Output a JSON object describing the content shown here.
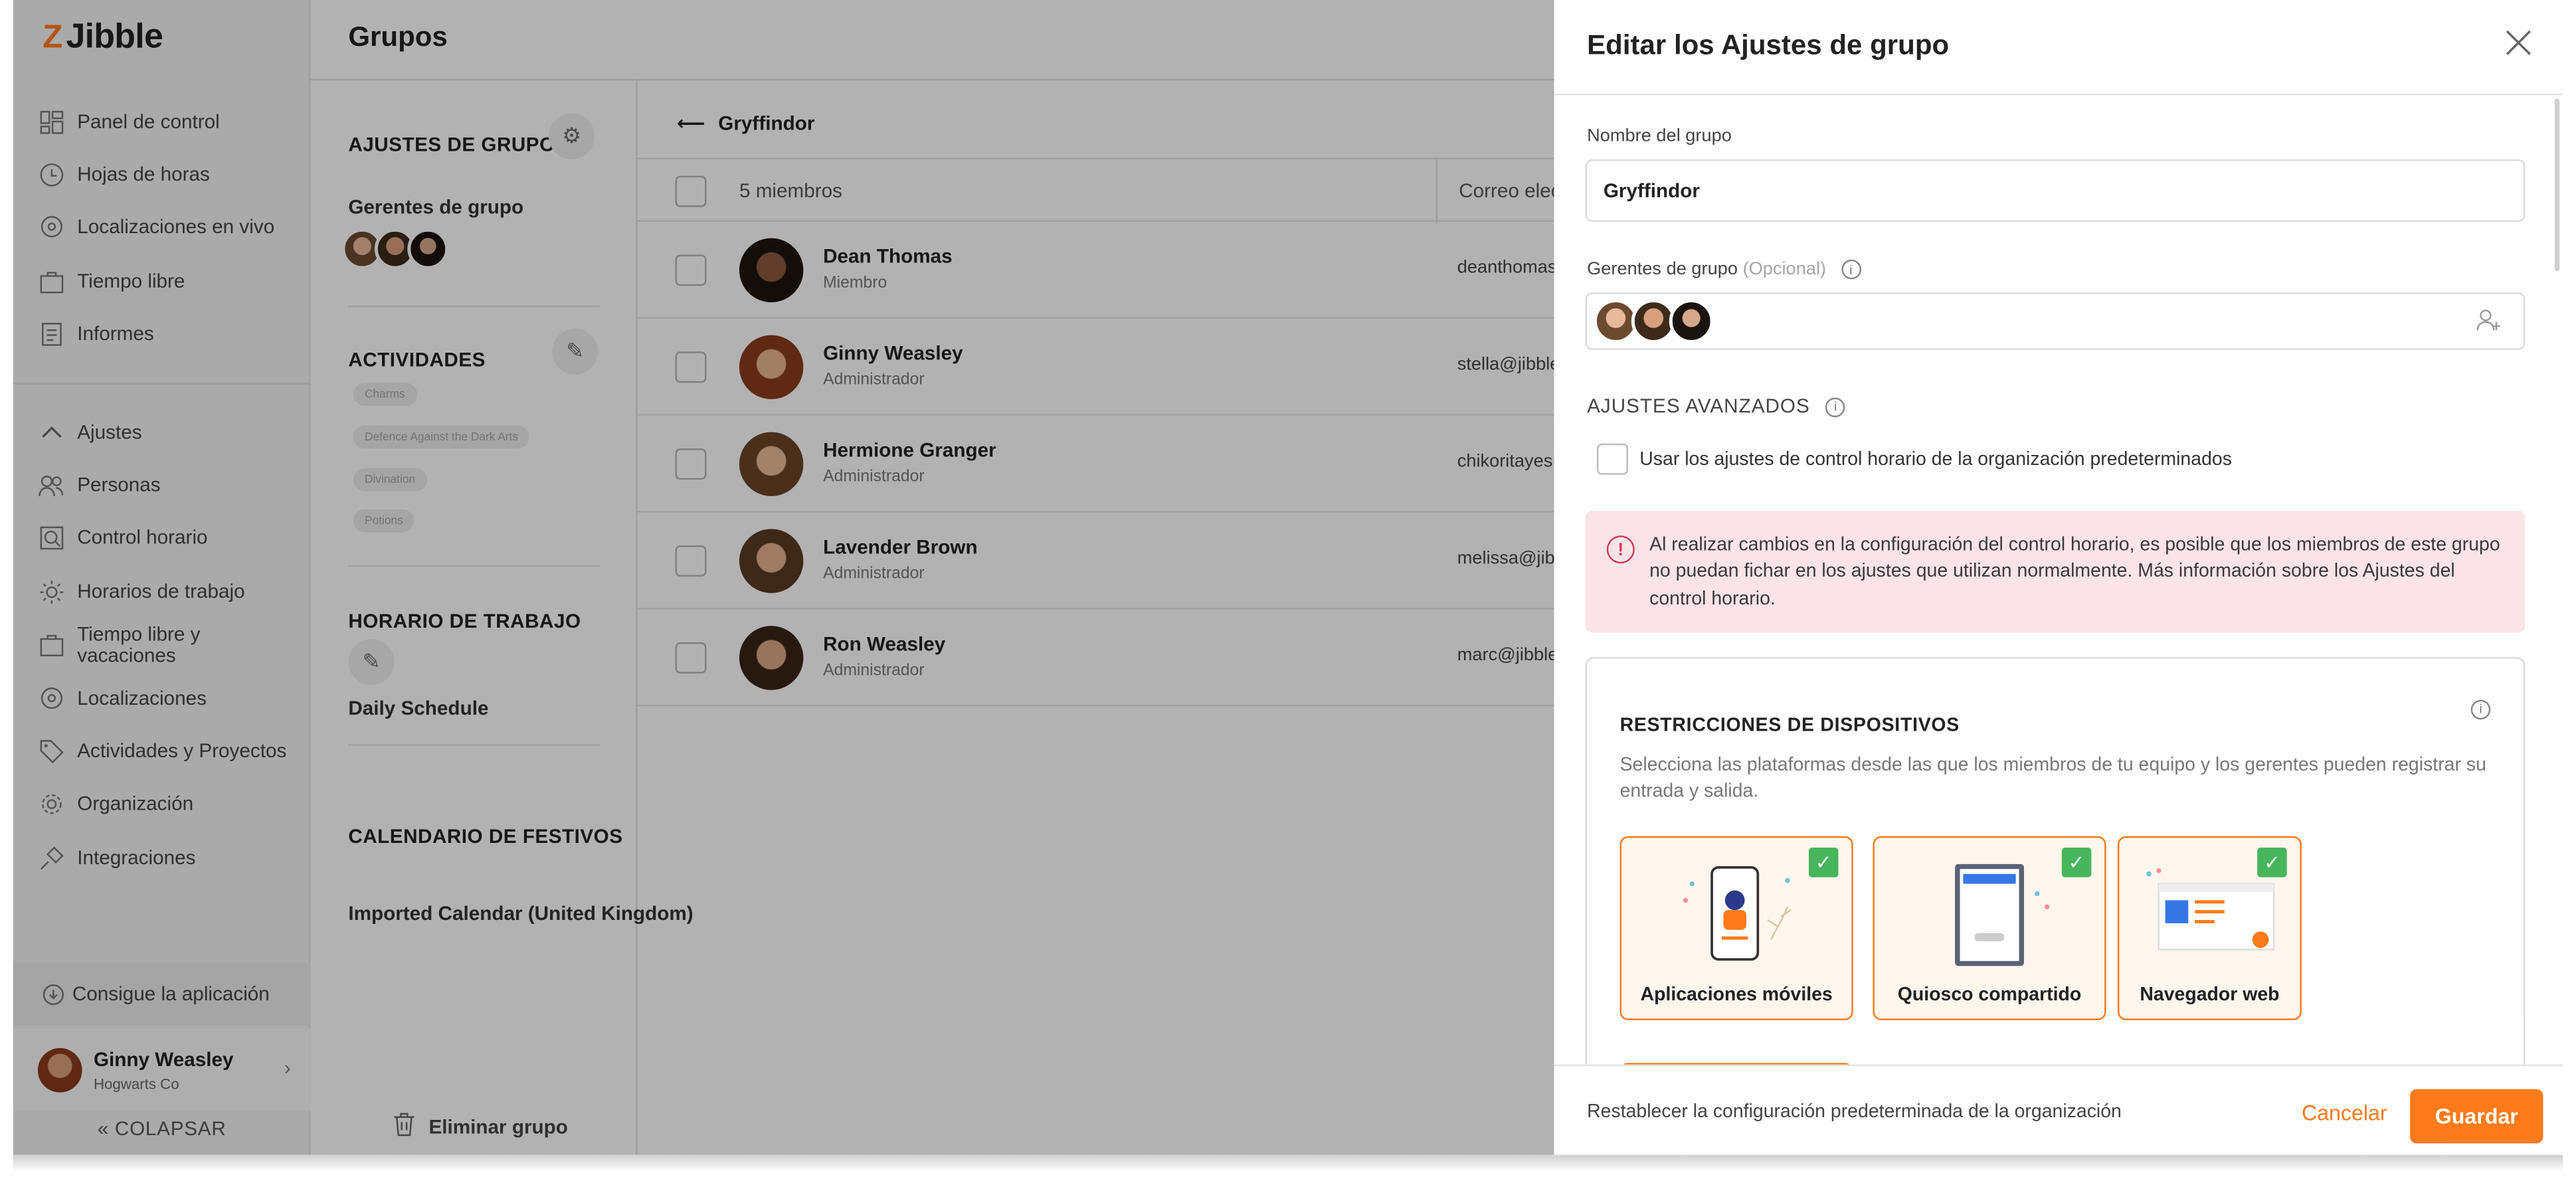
{
  "app": {
    "logo": "Jibble",
    "logo_mark": "Z"
  },
  "sidebar": {
    "items": [
      {
        "label": "Panel de control",
        "icon": "dashboard-icon"
      },
      {
        "label": "Hojas de horas",
        "icon": "clock-icon"
      },
      {
        "label": "Localizaciones en vivo",
        "icon": "location-icon"
      },
      {
        "label": "Tiempo libre",
        "icon": "suitcase-icon"
      },
      {
        "label": "Informes",
        "icon": "report-icon"
      }
    ],
    "settings_items": [
      {
        "label": "Ajustes",
        "icon": "chevron-up-icon"
      },
      {
        "label": "Personas",
        "icon": "people-icon"
      },
      {
        "label": "Control horario",
        "icon": "time-control-icon"
      },
      {
        "label": "Horarios de trabajo",
        "icon": "sun-icon"
      },
      {
        "label": "Tiempo libre y vacaciones",
        "icon": "suitcase-icon"
      },
      {
        "label": "Localizaciones",
        "icon": "location-icon"
      },
      {
        "label": "Actividades y Proyectos",
        "icon": "tag-icon"
      },
      {
        "label": "Organización",
        "icon": "gear-icon"
      },
      {
        "label": "Integraciones",
        "icon": "plug-icon"
      }
    ],
    "get_app": "Consigue la aplicación",
    "user_name": "Ginny Weasley",
    "user_org": "Hogwarts Co",
    "collapse": "COLAPSAR"
  },
  "header": {
    "title": "Grupos"
  },
  "group_panel": {
    "settings_title": "AJUSTES DE GRUPO",
    "managers_label": "Gerentes de grupo",
    "activities_title": "ACTIVIDADES",
    "activities": [
      "Charms",
      "Defence Against the Dark Arts",
      "Divination",
      "Potions"
    ],
    "schedule_title": "HORARIO DE TRABAJO",
    "schedule_name": "Daily Schedule",
    "holidays_title": "CALENDARIO DE FESTIVOS",
    "holidays_name": "Imported Calendar (United Kingdom)",
    "delete": "Eliminar grupo"
  },
  "members": {
    "group_name": "Gryffindor",
    "count": "5 miembros",
    "email_header": "Correo electrónico",
    "rows": [
      {
        "name": "Dean Thomas",
        "role": "Miembro",
        "email": "deanthomas@jibble.io"
      },
      {
        "name": "Ginny Weasley",
        "role": "Administrador",
        "email": "stella@jibble.io"
      },
      {
        "name": "Hermione Granger",
        "role": "Administrador",
        "email": "chikoritayes@jibble.io"
      },
      {
        "name": "Lavender Brown",
        "role": "Administrador",
        "email": "melissa@jibble.io"
      },
      {
        "name": "Ron Weasley",
        "role": "Administrador",
        "email": "marc@jibble.io"
      }
    ]
  },
  "drawer": {
    "title": "Editar los Ajustes de grupo",
    "name_label": "Nombre del grupo",
    "name_value": "Gryffindor",
    "managers_label": "Gerentes de grupo",
    "managers_optional": "(Opcional)",
    "advanced_title": "AJUSTES AVANZADOS",
    "use_default_label": "Usar los ajustes de control horario de la organización predeterminados",
    "alert_text": "Al realizar cambios en la configuración del control horario, es posible que los miembros de este grupo no puedan fichar en los ajustes que utilizan normalmente. Más información sobre los Ajustes del control horario.",
    "devices_title": "RESTRICCIONES DE DISPOSITIVOS",
    "devices_desc": "Selecciona las plataformas desde las que los miembros de tu equipo y los gerentes pueden registrar su entrada y salida.",
    "devices": [
      {
        "label": "Aplicaciones móviles",
        "icon": "mobile-app-icon",
        "checked": true
      },
      {
        "label": "Quiosco compartido",
        "icon": "kiosk-icon",
        "checked": true
      },
      {
        "label": "Navegador web",
        "icon": "web-browser-icon",
        "checked": true
      }
    ],
    "reset_label": "Restablecer la configuración predeterminada de la organización",
    "cancel_label": "Cancelar",
    "save_label": "Guardar"
  },
  "colors": {
    "accent": "#ff7a1a",
    "success": "#47b55c",
    "alert_bg": "#fbe4e8",
    "alert_icon": "#d43a5e"
  }
}
